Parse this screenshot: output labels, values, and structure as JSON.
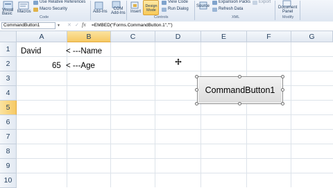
{
  "ribbon": {
    "code": {
      "visual_basic": "Visual\nBasic",
      "macros": "Macros",
      "use_relative_refs": "Use Relative References",
      "macro_security": "Macro Security",
      "group_label": "Code"
    },
    "addins": {
      "addins": "Add-Ins",
      "com_addins": "COM\nAdd-Ins",
      "group_label": "Add-Ins"
    },
    "controls": {
      "insert": "Insert",
      "design_mode": "Design\nMode",
      "view_code": "View Code",
      "run_dialog": "Run Dialog",
      "group_label": "Controls"
    },
    "xml": {
      "source": "Source",
      "expansion_packs": "Expansion Packs",
      "refresh_data": "Refresh Data",
      "export": "Export",
      "group_label": "XML"
    },
    "modify": {
      "document_panel": "Document\nPanel",
      "group_label": "Modify"
    },
    "colors": {
      "design_mode_active": "#f8c957"
    }
  },
  "formula_bar": {
    "name_box": "CommandButton1",
    "formula": "=EMBED(\"Forms.CommandButton.1\",\"\")"
  },
  "grid": {
    "columns": [
      "A",
      "B",
      "C",
      "D",
      "E",
      "F",
      "G"
    ],
    "rows": [
      "1",
      "2",
      "3",
      "4",
      "5",
      "6",
      "7",
      "8",
      "9",
      "10"
    ],
    "selected_column": "B",
    "selected_row": "5",
    "cells": {
      "A1": "David",
      "B1": "< ---Name",
      "A2": "65",
      "B2": "< ---Age"
    }
  },
  "command_button": {
    "caption": "CommandButton1"
  }
}
